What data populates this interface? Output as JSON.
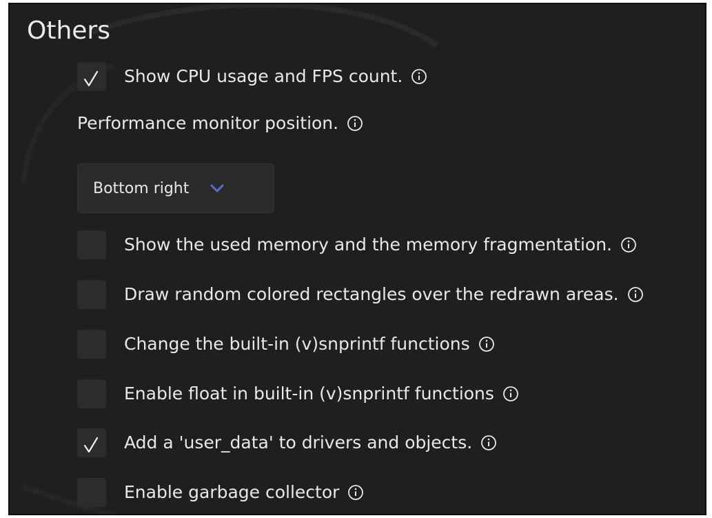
{
  "section": {
    "title": "Others"
  },
  "settings": {
    "cpu_fps": {
      "label": "Show CPU usage and FPS count.",
      "checked": true
    },
    "perf_position": {
      "label": "Performance monitor position.",
      "selected": "Bottom right"
    },
    "mem_usage": {
      "label": "Show the used memory and the memory fragmentation.",
      "checked": false
    },
    "redraw_rects": {
      "label": "Draw random colored rectangles over the redrawn areas.",
      "checked": false
    },
    "builtin_snprintf": {
      "label": "Change the built-in (v)snprintf functions",
      "checked": false
    },
    "float_snprintf": {
      "label": "Enable float in built-in (v)snprintf functions",
      "checked": false
    },
    "user_data": {
      "label": "Add a 'user_data' to drivers and objects.",
      "checked": true
    },
    "garbage_collector": {
      "label": "Enable garbage collector",
      "checked": false
    }
  },
  "icons": {
    "info": "info-icon",
    "check": "checkmark-icon",
    "chevron": "chevron-down-icon"
  },
  "colors": {
    "background": "#1f1f1f",
    "checkbox": "#2c2c2c",
    "text": "#e8e8e8",
    "chevron": "#5a6fd6"
  }
}
